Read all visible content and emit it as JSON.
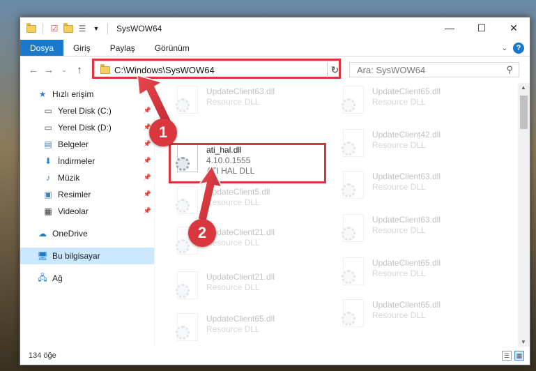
{
  "window": {
    "title": "SysWOW64",
    "controls": {
      "minimize": "—",
      "maximize": "☐",
      "close": "✕"
    }
  },
  "ribbon": {
    "tabs": [
      {
        "label": "Dosya",
        "active": true
      },
      {
        "label": "Giriş"
      },
      {
        "label": "Paylaş"
      },
      {
        "label": "Görünüm"
      }
    ],
    "help": "?"
  },
  "address": {
    "path": "C:\\Windows\\SysWOW64",
    "search_placeholder": "Ara: SysWOW64"
  },
  "sidebar": {
    "items": [
      {
        "label": "Hızlı erişim",
        "icon": "star-icon",
        "level": 0
      },
      {
        "label": "Yerel Disk (C:)",
        "icon": "drive-icon",
        "level": 1,
        "pinned": true
      },
      {
        "label": "Yerel Disk (D:)",
        "icon": "drive-icon",
        "level": 1,
        "pinned": true
      },
      {
        "label": "Belgeler",
        "icon": "documents-icon",
        "level": 1,
        "pinned": true
      },
      {
        "label": "İndirmeler",
        "icon": "download-icon",
        "level": 1,
        "pinned": true
      },
      {
        "label": "Müzik",
        "icon": "music-icon",
        "level": 1,
        "pinned": true
      },
      {
        "label": "Resimler",
        "icon": "pictures-icon",
        "level": 1,
        "pinned": true
      },
      {
        "label": "Videolar",
        "icon": "videos-icon",
        "level": 1,
        "pinned": true
      },
      {
        "label": "OneDrive",
        "icon": "cloud-icon",
        "level": 0
      },
      {
        "label": "Bu bilgisayar",
        "icon": "computer-icon",
        "level": 0,
        "selected": true
      },
      {
        "label": "Ağ",
        "icon": "network-icon",
        "level": 0
      }
    ]
  },
  "files": {
    "highlighted": {
      "name": "ati_hal.dll",
      "version": "4.10.0.1555",
      "description": "ATI HAL DLL"
    },
    "faded_left": [
      {
        "name": "UpdateClient63.dll",
        "type": "Resource DLL"
      },
      {
        "name": "UpdateClient5.dll",
        "type": "Resource DLL"
      },
      {
        "name": "UpdateClient21.dll",
        "type": "Resource DLL"
      },
      {
        "name": "UpdateClient21.dll",
        "type": "Resource DLL"
      },
      {
        "name": "UpdateClient65.dll",
        "type": "Resource DLL"
      }
    ],
    "faded_right": [
      {
        "name": "UpdateClient65.dll",
        "type": "Resource DLL"
      },
      {
        "name": "UpdateClient42.dll",
        "type": "Resource DLL"
      },
      {
        "name": "UpdateClient63.dll",
        "type": "Resource DLL"
      },
      {
        "name": "UpdateClient63.dll",
        "type": "Resource DLL"
      },
      {
        "name": "UpdateClient65.dll",
        "type": "Resource DLL"
      },
      {
        "name": "UpdateClient65.dll",
        "type": "Resource DLL"
      }
    ]
  },
  "status": {
    "item_count": "134 öğe"
  },
  "callouts": {
    "first": "1",
    "second": "2"
  },
  "colors": {
    "accent": "#1979ca",
    "highlight": "#d9363e",
    "selection": "#cce8ff"
  }
}
